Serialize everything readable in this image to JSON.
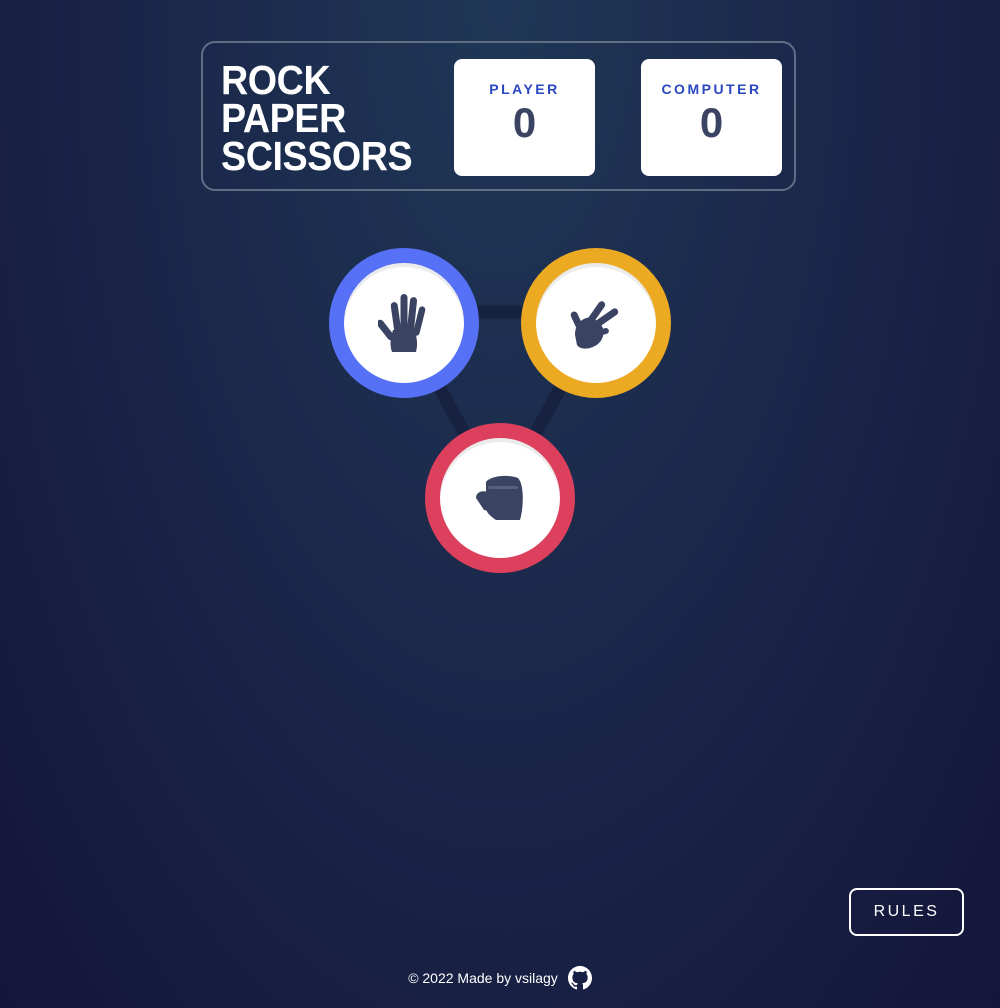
{
  "header": {
    "title_lines": [
      "ROCK",
      "PAPER",
      "SCISSORS"
    ],
    "player": {
      "label": "PLAYER",
      "score": "0"
    },
    "computer": {
      "label": "COMPUTER",
      "score": "0"
    }
  },
  "board": {
    "tokens": [
      {
        "name": "paper",
        "icon": "hand-paper-icon",
        "color": "#5671f5"
      },
      {
        "name": "scissors",
        "icon": "hand-scissors-icon",
        "color": "#eca922"
      },
      {
        "name": "rock",
        "icon": "hand-rock-icon",
        "color": "#dd405d"
      }
    ]
  },
  "rules_button": {
    "label": "RULES"
  },
  "footer": {
    "text": "© 2022 Made by vsilagy",
    "icon": "github-icon"
  }
}
